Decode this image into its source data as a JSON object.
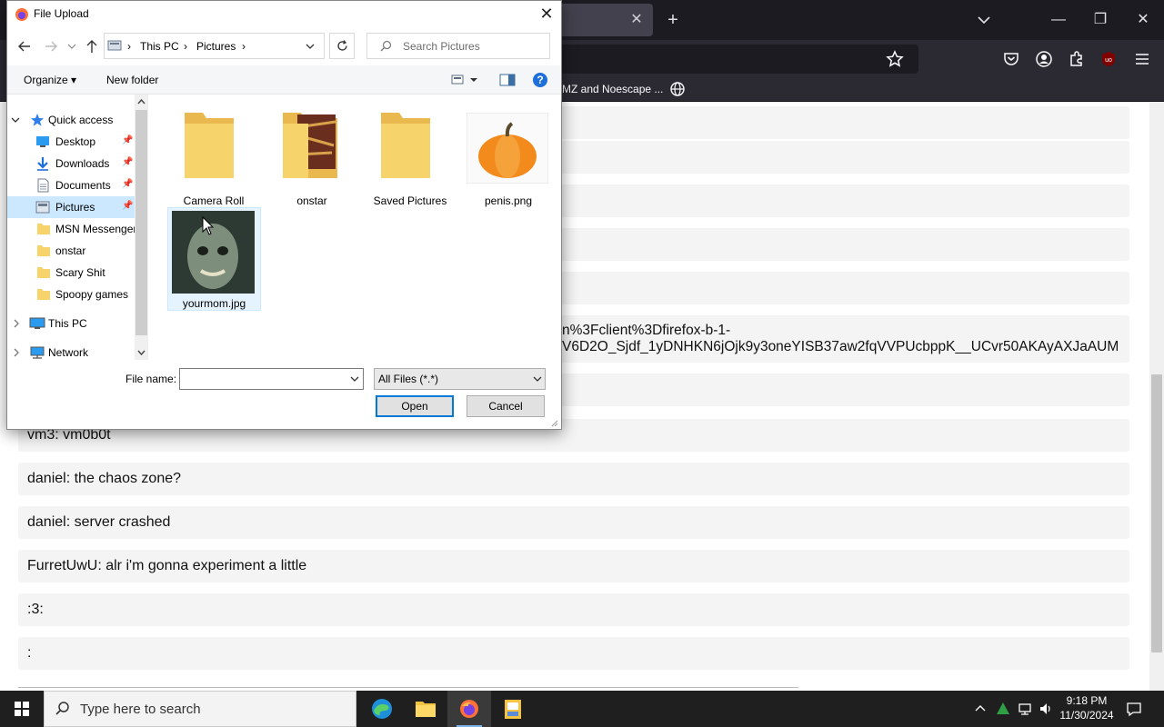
{
  "browser": {
    "new_tab_glyph": "+",
    "tab_close_glyph": "✕",
    "bookmark_text": "MZ and Noescape ...",
    "window_controls": [
      "—",
      "❐",
      "✕"
    ]
  },
  "chat": {
    "url_line1": "n%3Fclient%3Dfirefox-b-1-",
    "url_line2": "V6D2O_Sjdf_1yDNHKN6jOjk9y3oneYISB37aw2fqVVPUcbppK__UCvr50AKAyAXJaAUM",
    "messages": [
      "vm3: vm0b0t",
      "daniel: the chaos zone?",
      "daniel: server crashed",
      "FurretUwU: alr i'm gonna experiment a little",
      ":3:",
      ":"
    ]
  },
  "dialog": {
    "title": "File Upload",
    "close_glyph": "✕",
    "breadcrumb": [
      "This PC",
      "Pictures"
    ],
    "search_placeholder": "Search Pictures",
    "toolbar": {
      "organize": "Organize ▾",
      "new_folder": "New folder"
    },
    "nav": {
      "quick_access": "Quick access",
      "desktop": "Desktop",
      "downloads": "Downloads",
      "documents": "Documents",
      "pictures": "Pictures",
      "msn": "MSN Messenger",
      "onstar": "onstar",
      "scary": "Scary Shit",
      "spoopy": "Spoopy games",
      "this_pc": "This PC",
      "network": "Network"
    },
    "files": {
      "camera_roll": "Camera Roll",
      "onstar": "onstar",
      "saved_pictures": "Saved Pictures",
      "penis": "penis.png",
      "yourmom": "yourmom.jpg"
    },
    "file_name_label": "File name:",
    "file_name_value": "",
    "filter_value": "All Files (*.*)",
    "open_label": "Open",
    "cancel_label": "Cancel"
  },
  "taskbar": {
    "search_placeholder": "Type here to search",
    "time": "9:18 PM",
    "date": "11/30/2024"
  },
  "colors": {
    "accent": "#0078d7",
    "folder": "#f7d46b",
    "selection": "#cce8ff"
  }
}
